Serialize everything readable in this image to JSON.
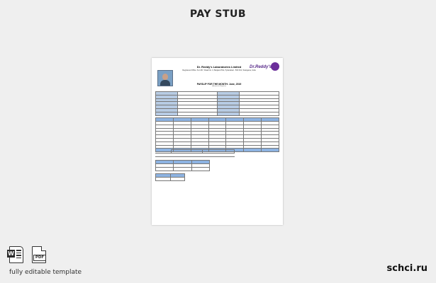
{
  "page": {
    "title": "PAY STUB"
  },
  "document": {
    "company_name": "Dr. Reddy's Laboratories Limited",
    "company_address": "Registered Office: 8-2-337, Road No. 3, Banjara Hills, Hyderabad - 500 034, Telangana, India",
    "logo_text": "Dr.Reddy's",
    "slip_title": "PAYSLIP FOR THE MONTH: June, 2019",
    "slip_subtitle": "(Amount in Rupees)"
  },
  "footer": {
    "formats": [
      "W",
      "PDF"
    ],
    "tagline": "fully editable template",
    "site": "schci.ru"
  }
}
